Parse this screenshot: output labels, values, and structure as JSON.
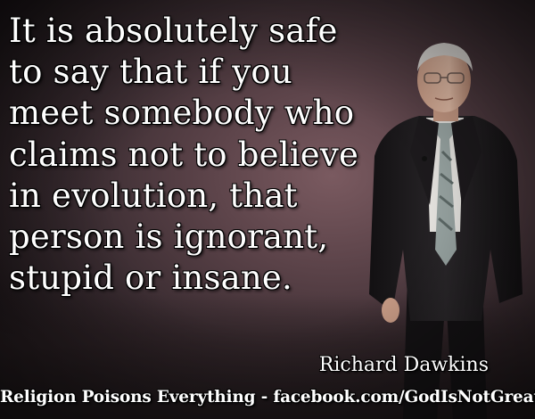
{
  "quote": {
    "lines": [
      "It is absolutely safe",
      "to say that if you",
      "meet somebody who",
      "claims not to believe",
      "in evolution, that",
      "person is ignorant,",
      "stupid or insane."
    ]
  },
  "author": "Richard Dawkins",
  "footer": "Religion Poisons Everything - facebook.com/GodIsNotGreat",
  "colors": {
    "text": "#ffffff",
    "background": "#5a4248",
    "suit": "#1c1a1c"
  }
}
